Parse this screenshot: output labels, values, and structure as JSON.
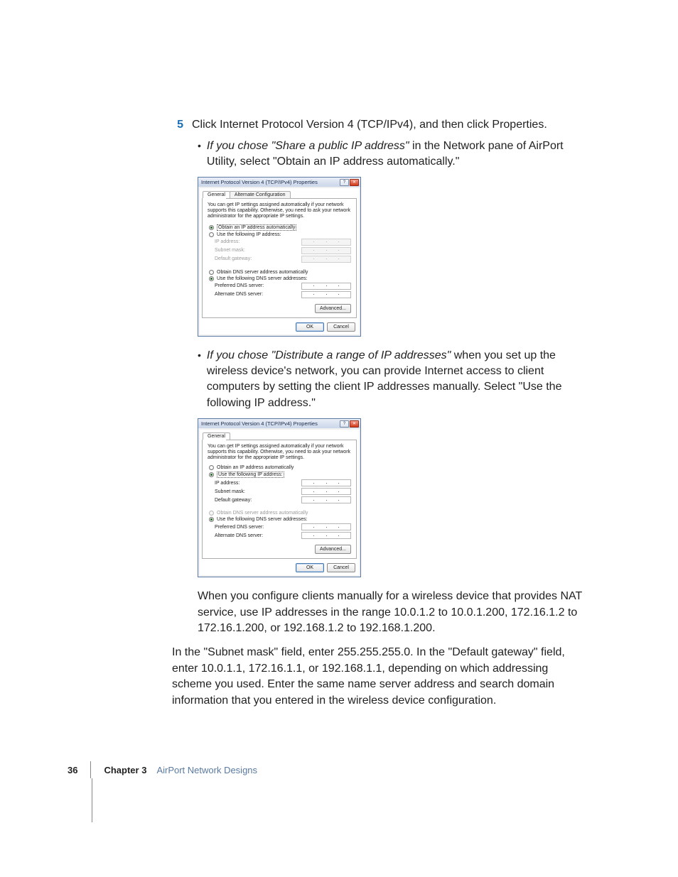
{
  "step": {
    "number": "5",
    "text": "Click Internet Protocol Version 4 (TCP/IPv4), and then click Properties."
  },
  "bullet1": {
    "lead": "If you chose \"Share a public IP address\"",
    "rest": " in the Network pane of AirPort Utility, select \"Obtain an IP address automatically.\""
  },
  "dialog1": {
    "title": "Internet Protocol Version 4 (TCP/IPv4) Properties",
    "tab_general": "General",
    "tab_alt": "Alternate Configuration",
    "intro": "You can get IP settings assigned automatically if your network supports this capability. Otherwise, you need to ask your network administrator for the appropriate IP settings.",
    "r_obtain_ip": "Obtain an IP address automatically",
    "r_use_ip": "Use the following IP address:",
    "f_ip": "IP address:",
    "f_mask": "Subnet mask:",
    "f_gw": "Default gateway:",
    "r_obtain_dns": "Obtain DNS server address automatically",
    "r_use_dns": "Use the following DNS server addresses:",
    "f_pref_dns": "Preferred DNS server:",
    "f_alt_dns": "Alternate DNS server:",
    "btn_adv": "Advanced...",
    "btn_ok": "OK",
    "btn_cancel": "Cancel",
    "help_glyph": "?",
    "close_glyph": "✕"
  },
  "bullet2": {
    "lead": "If you chose \"Distribute a range of IP addresses\"",
    "rest": " when you set up the wireless device's network, you can provide Internet access to client computers by setting the client IP addresses manually. Select \"Use the following IP address.\""
  },
  "dialog2": {
    "title": "Internet Protocol Version 4 (TCP/IPv4) Properties",
    "tab_general": "General",
    "intro": "You can get IP settings assigned automatically if your network supports this capability. Otherwise, you need to ask your network administrator for the appropriate IP settings.",
    "r_obtain_ip": "Obtain an IP address automatically",
    "r_use_ip": "Use the following IP address:",
    "f_ip": "IP address:",
    "f_mask": "Subnet mask:",
    "f_gw": "Default gateway:",
    "r_obtain_dns": "Obtain DNS server address automatically",
    "r_use_dns": "Use the following DNS server addresses:",
    "f_pref_dns": "Preferred DNS server:",
    "f_alt_dns": "Alternate DNS server:",
    "btn_adv": "Advanced...",
    "btn_ok": "OK",
    "btn_cancel": "Cancel",
    "help_glyph": "?",
    "close_glyph": "✕"
  },
  "para_nat": "When you configure clients manually for a wireless device that provides NAT service, use IP addresses in the range 10.0.1.2 to 10.0.1.200, 172.16.1.2 to 172.16.1.200, or 192.168.1.2 to 192.168.1.200.",
  "para_subnet": "In the \"Subnet mask\" field, enter 255.255.255.0. In the \"Default gateway\" field, enter 10.0.1.1, 172.16.1.1, or 192.168.1.1, depending on which addressing scheme you used. Enter the same name server address and search domain information that you entered in the wireless device configuration.",
  "footer": {
    "page": "36",
    "chapter_label": "Chapter 3",
    "chapter_title": "AirPort Network Designs"
  }
}
